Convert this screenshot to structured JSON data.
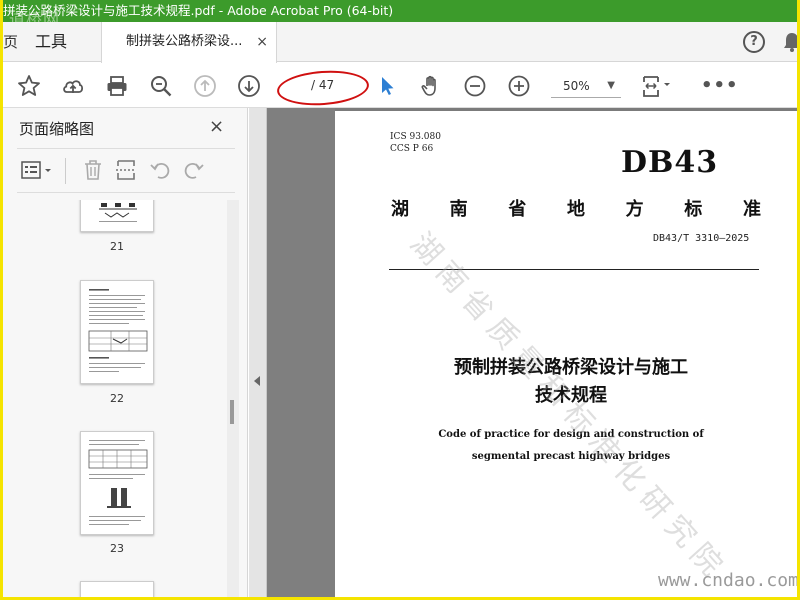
{
  "window": {
    "title": "拼装公路桥梁设计与施工技术规程.pdf - Adobe Acrobat Pro (64-bit)",
    "brand_watermark": "道桥网"
  },
  "tabs": {
    "home_fragment": "页",
    "tools": "工具",
    "document": "制拼装公路桥梁设...",
    "close": "×"
  },
  "header_icons": [
    "help-icon",
    "bell-icon"
  ],
  "toolbar": {
    "icons": [
      "star-icon",
      "upload-icon",
      "print-icon",
      "zoom-search-icon",
      "page-up-icon",
      "page-down-icon",
      "select-arrow-icon",
      "hand-icon",
      "zoom-out-icon",
      "zoom-in-icon",
      "page-layout-icon",
      "more-icon"
    ],
    "page_current": "",
    "page_total": "/ 47",
    "zoom": "50%",
    "more": "•••"
  },
  "sidebar": {
    "title": "页面缩略图",
    "close": "×",
    "thumbnails": [
      {
        "label": "21"
      },
      {
        "label": "22"
      },
      {
        "label": "23"
      }
    ]
  },
  "document": {
    "ics": "ICS  93.080",
    "ccs": "CCS  P  66",
    "code": "DB43",
    "province_chars": [
      "湖",
      "南",
      "省",
      "地",
      "方",
      "标",
      "准"
    ],
    "standard_no": "DB43/T 3310—2025",
    "title_line1": "预制拼装公路桥梁设计与施工",
    "title_line2": "技术规程",
    "en_line1": "Code of practice for design and construction of",
    "en_line2": "segmental precast highway bridges",
    "diagonal_watermark": "湖南省质量和标准化研究院"
  },
  "site_watermark": "www.cndao.com",
  "colors": {
    "title_bar": "#3c9b2b",
    "frame": "#f5e400",
    "annotation": "#d01010",
    "select_tool": "#2d7fd3"
  }
}
